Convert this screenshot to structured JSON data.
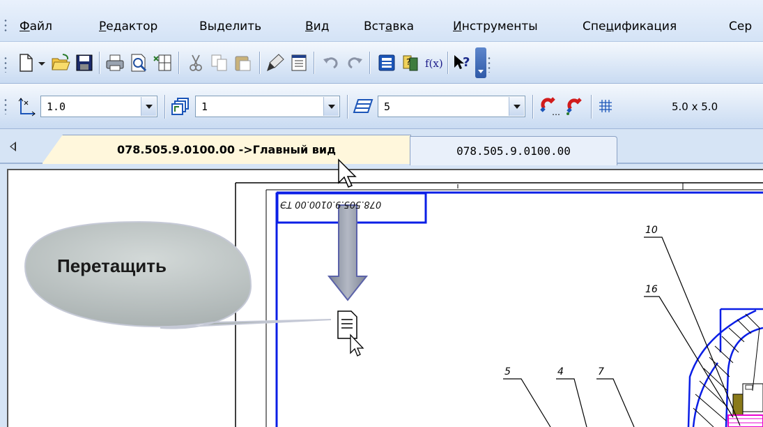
{
  "menu": {
    "items": [
      {
        "pre": "",
        "u": "Ф",
        "post": "айл"
      },
      {
        "pre": "",
        "u": "Р",
        "post": "едактор"
      },
      {
        "pre": "Вы",
        "u": "д",
        "post": "елить"
      },
      {
        "pre": "",
        "u": "В",
        "post": "ид"
      },
      {
        "pre": "Вст",
        "u": "а",
        "post": "вка"
      },
      {
        "pre": "",
        "u": "И",
        "post": "нструменты"
      },
      {
        "pre": "Спе",
        "u": "ц",
        "post": "ификация"
      },
      {
        "pre": "Сер",
        "u": "",
        "post": ""
      }
    ]
  },
  "toolbar2": {
    "scale_value": "1.0",
    "layer_value": "1",
    "style_value": "5",
    "grid_step": "5.0 x 5.0"
  },
  "tabs": {
    "active": "078.505.9.0100.00 ->Главный вид",
    "inactive": "078.505.9.0100.00"
  },
  "callout": {
    "label": "Перетащить"
  },
  "drawing": {
    "stamp": "078.505.9.0100.00 ТЭ",
    "leaders": [
      "10",
      "16",
      "5",
      "4",
      "7"
    ]
  },
  "colors": {
    "frame_blue": "#0a1ee6",
    "callout_fill": "#bfc7c6",
    "arrow_fill": "#9aa0ad",
    "magenta": "#e800d0"
  }
}
